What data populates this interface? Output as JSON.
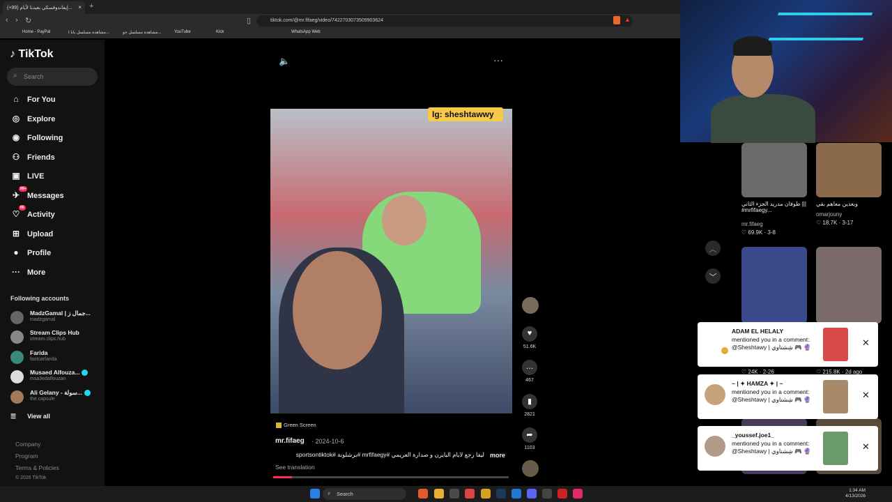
{
  "browser": {
    "tab_title": "(+99) إيفاندوفسكي بعيدنا لأيام...",
    "tab_close": "×",
    "new_tab": "+",
    "url": "tiktok.com/@mr.fifaeg/video/7422703073509903624",
    "bookmarks": [
      "Home - PayPal",
      "مشاهدة مسلسل بابا ا...",
      "مشاهدة مسلسل جو...",
      "YouTube",
      "Kick",
      "WhatsApp Web"
    ]
  },
  "sidebar": {
    "logo": "TikTok",
    "search_placeholder": "Search",
    "nav": [
      {
        "label": "For You",
        "icon": "home-icon"
      },
      {
        "label": "Explore",
        "icon": "compass-icon"
      },
      {
        "label": "Following",
        "icon": "following-icon"
      },
      {
        "label": "Friends",
        "icon": "friends-icon"
      },
      {
        "label": "LIVE",
        "icon": "live-icon"
      },
      {
        "label": "Messages",
        "icon": "messages-icon",
        "badge": "99+"
      },
      {
        "label": "Activity",
        "icon": "activity-icon",
        "badge": "86"
      },
      {
        "label": "Upload",
        "icon": "upload-icon"
      },
      {
        "label": "Profile",
        "icon": "profile-icon"
      },
      {
        "label": "More",
        "icon": "more-icon"
      }
    ],
    "following_header": "Following accounts",
    "accounts": [
      {
        "name": "MadzGamal | جمال ز...",
        "handle": "madzgamal",
        "verified": false
      },
      {
        "name": "Stream Clips Hub",
        "handle": "stream.clips.hub",
        "verified": false
      },
      {
        "name": "Farida",
        "handle": "fastcarfarida",
        "verified": false
      },
      {
        "name": "Musaed Alfouza...",
        "handle": "msa3edalfouzan",
        "verified": true
      },
      {
        "name": "Ali Gelany - سولة...",
        "handle": "the.capsule",
        "verified": true
      }
    ],
    "view_all": "View all",
    "footer": [
      "Company",
      "Program",
      "Terms & Policies",
      "© 2026 TikTok"
    ]
  },
  "video": {
    "overlay_tag": "Ig: sheshtawwy",
    "green_screen": "Green Screen",
    "author": "mr.fifaeg",
    "date": "2024-10-6",
    "caption": "ليفا رجع لايام البايرن و صدارة العريمي #mrfifaegy #برشلونة #sportsontiktok",
    "more": "more",
    "see_translation": "See translation",
    "progress": 0.08
  },
  "actions": {
    "likes": "51.6K",
    "comments": "467",
    "saves": "2821",
    "shares": "1103"
  },
  "feed": [
    {
      "title": "طوفان مدريد الجزء الثاني ||| #mrfifaegy...",
      "user": "mr.fifaeg",
      "stat": "69.9K · 3-8"
    },
    {
      "title": "وبعدين معاهم بقي",
      "user": "omarjouny",
      "stat": "18.7K · 3-17"
    },
    {
      "stat": "24K · 2-26"
    },
    {
      "stat": "215.8K · 2d ago"
    }
  ],
  "notifications": [
    {
      "user": "ADAM EL HELALY",
      "text": "mentioned you in a comment: @Sheshtawy | شِشتاوي 🎮 🔮"
    },
    {
      "user": "~ | ✦ HAMZA ✦ | ~",
      "text": "mentioned you in a comment: @Sheshtawy | شِشتاوي 🎮 🔮"
    },
    {
      "user": "_youssef.joe1_",
      "text": "mentioned you in a comment: @Sheshtawy | شِشتاوي 🎮 🔮"
    }
  ],
  "taskbar": {
    "search": "Search",
    "time": "1:34 AM",
    "date": "4/13/2026"
  },
  "colors": {
    "accent": "#fe2c55",
    "verified": "#20d5ec",
    "tag": "#f7c948"
  }
}
